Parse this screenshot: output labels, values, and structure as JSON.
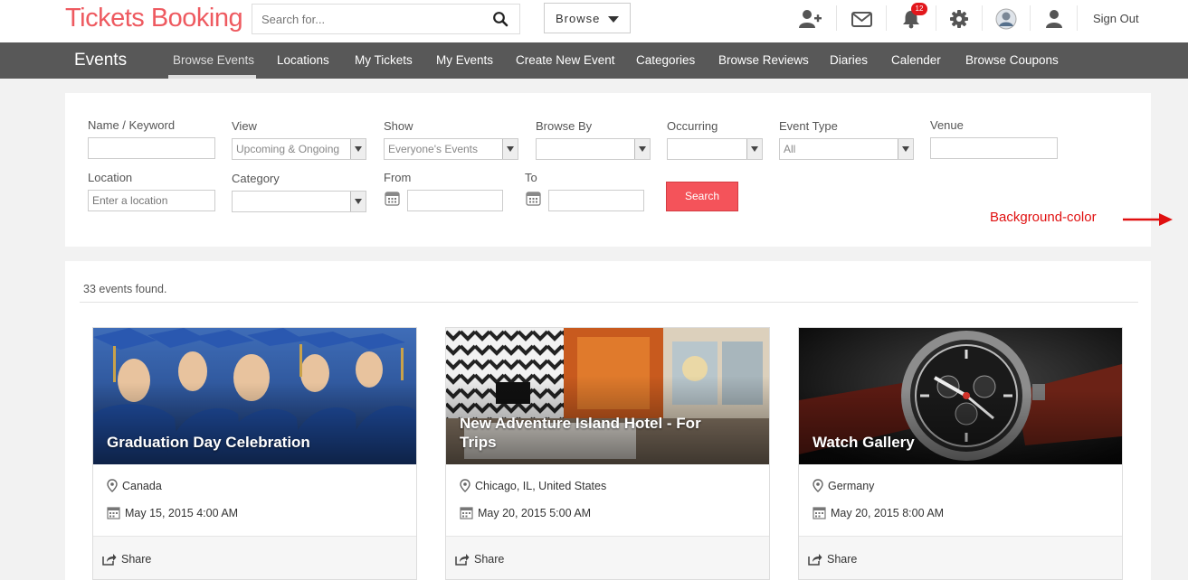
{
  "header": {
    "logo": "Tickets Booking",
    "search": {
      "placeholder": "Search for..."
    },
    "browse_label": "Browse",
    "notifications_count": "12",
    "signout_label": "Sign Out",
    "icons": [
      "add-user-icon",
      "mail-icon",
      "bell-icon",
      "gear-icon",
      "avatar",
      "user-icon"
    ]
  },
  "nav": {
    "title": "Events",
    "items": [
      {
        "label": "Browse Events",
        "active": true
      },
      {
        "label": "Locations"
      },
      {
        "label": "My Tickets"
      },
      {
        "label": "My Events"
      },
      {
        "label": "Create New Event"
      },
      {
        "label": "Categories"
      },
      {
        "label": "Browse Reviews"
      },
      {
        "label": "Diaries"
      },
      {
        "label": "Calender"
      },
      {
        "label": "Browse Coupons"
      }
    ]
  },
  "filters": {
    "name_label": "Name / Keyword",
    "view_label": "View",
    "view_value": "Upcoming & Ongoing",
    "show_label": "Show",
    "show_value": "Everyone's Events",
    "browse_by_label": "Browse By",
    "occurring_label": "Occurring",
    "event_type_label": "Event Type",
    "event_type_value": "All",
    "venue_label": "Venue",
    "location_label": "Location",
    "location_placeholder": "Enter a location",
    "category_label": "Category",
    "from_label": "From",
    "to_label": "To",
    "search_button": "Search"
  },
  "annotation": "Background-color",
  "colors": {
    "brand": "#ee5a60",
    "nav_bg": "#585858",
    "button": "#f4535a",
    "annotation": "#e01010"
  },
  "results": {
    "count_text": "33 events found.",
    "share_label": "Share",
    "events": [
      {
        "title": "Graduation Day Celebration",
        "location": "Canada",
        "date": "May 15, 2015 4:00 AM"
      },
      {
        "title": "New Adventure Island Hotel - For Trips",
        "location": "Chicago, IL, United States",
        "date": "May 20, 2015 5:00 AM"
      },
      {
        "title": "Watch Gallery",
        "location": "Germany",
        "date": "May 20, 2015 8:00 AM"
      }
    ]
  }
}
